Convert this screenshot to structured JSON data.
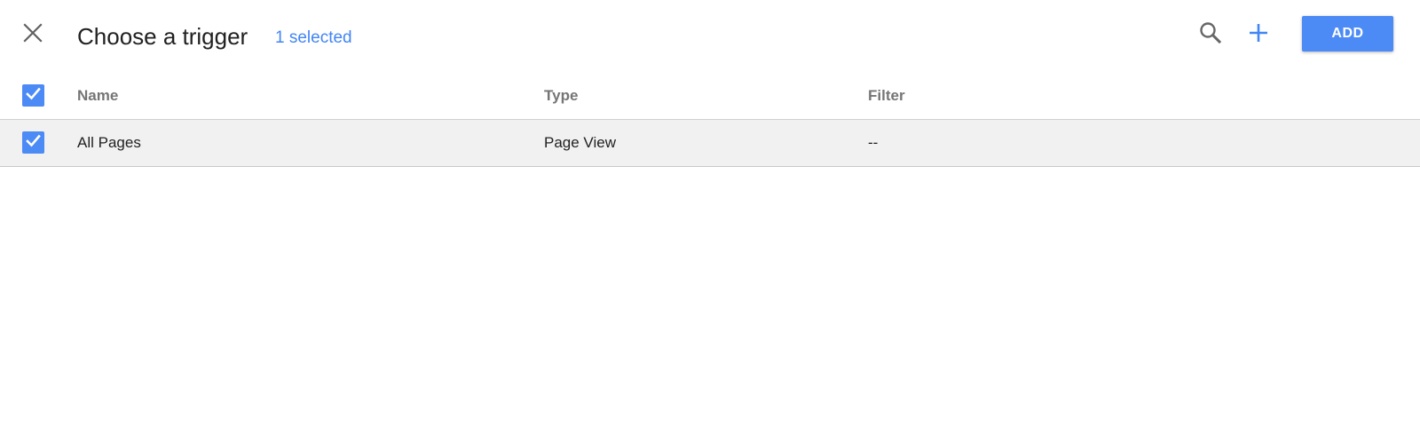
{
  "header": {
    "title": "Choose a trigger",
    "selected_text": "1 selected",
    "add_label": "ADD",
    "icons": {
      "close": "close-icon",
      "search": "search-icon",
      "add": "plus-icon"
    }
  },
  "table": {
    "columns": [
      "Name",
      "Type",
      "Filter"
    ],
    "rows": [
      {
        "selected": true,
        "name": "All Pages",
        "type": "Page View",
        "filter": "--"
      }
    ],
    "all_selected": true
  },
  "colors": {
    "accent": "#4285f4",
    "button": "#4c8af5",
    "row_selected_bg": "#f1f1f1"
  }
}
